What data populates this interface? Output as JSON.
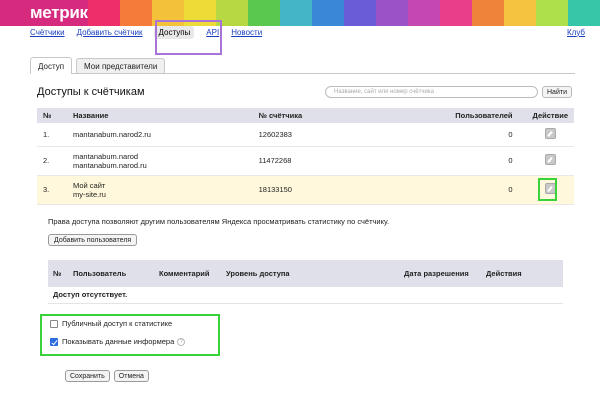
{
  "header": {
    "logo": "метрика",
    "stripe_colors": [
      "#ee2e6a",
      "#f47b3a",
      "#f4c13a",
      "#eddc36",
      "#b6d842",
      "#5ac84e",
      "#42b6c6",
      "#3a87d8",
      "#6a5cd6",
      "#9b52c7",
      "#c447b3",
      "#e93f8b",
      "#f0833a",
      "#f6c341",
      "#ade04a",
      "#37c6a7"
    ]
  },
  "nav": {
    "items": [
      "Счётчики",
      "Добавить счётчик",
      "Доступы",
      "API",
      "Новости"
    ],
    "active_index": 2,
    "club": "Клуб"
  },
  "tabs": {
    "items": [
      "Доступ",
      "Мои представители"
    ],
    "active_index": 0
  },
  "counters": {
    "title": "Доступы к счётчикам",
    "search_placeholder": "Название, сайт или номер счётчика",
    "find_button": "Найти",
    "columns": [
      "№",
      "Название",
      "№ счётчика",
      "Пользователей",
      "Действие"
    ],
    "rows": [
      {
        "n": "1.",
        "name": [
          "mantanabum.narod2.ru"
        ],
        "id": "12602383",
        "users": "0"
      },
      {
        "n": "2.",
        "name": [
          "mantanabum.narod",
          "mantanabum.narod.ru"
        ],
        "id": "11472268",
        "users": "0"
      },
      {
        "n": "3.",
        "name": [
          "Мой сайт",
          "my-site.ru"
        ],
        "id": "18133150",
        "users": "0"
      }
    ],
    "highlighted_row": 2
  },
  "help_text": "Права доступа позволяют другим пользователям Яндекса просматривать статистику по счётчику.",
  "add_user_button": "Добавить пользователя",
  "permissions": {
    "columns": [
      "№",
      "Пользователь",
      "Комментарий",
      "Уровень доступа",
      "Дата разрешения",
      "Действия"
    ],
    "empty": "Доступ отсутствует."
  },
  "options": {
    "public_access": {
      "label": "Публичный доступ к статистике",
      "checked": false
    },
    "show_informer": {
      "label": "Показывать данные информера",
      "checked": true,
      "help": "?"
    }
  },
  "buttons": {
    "save": "Сохранить",
    "cancel": "Отмена"
  }
}
